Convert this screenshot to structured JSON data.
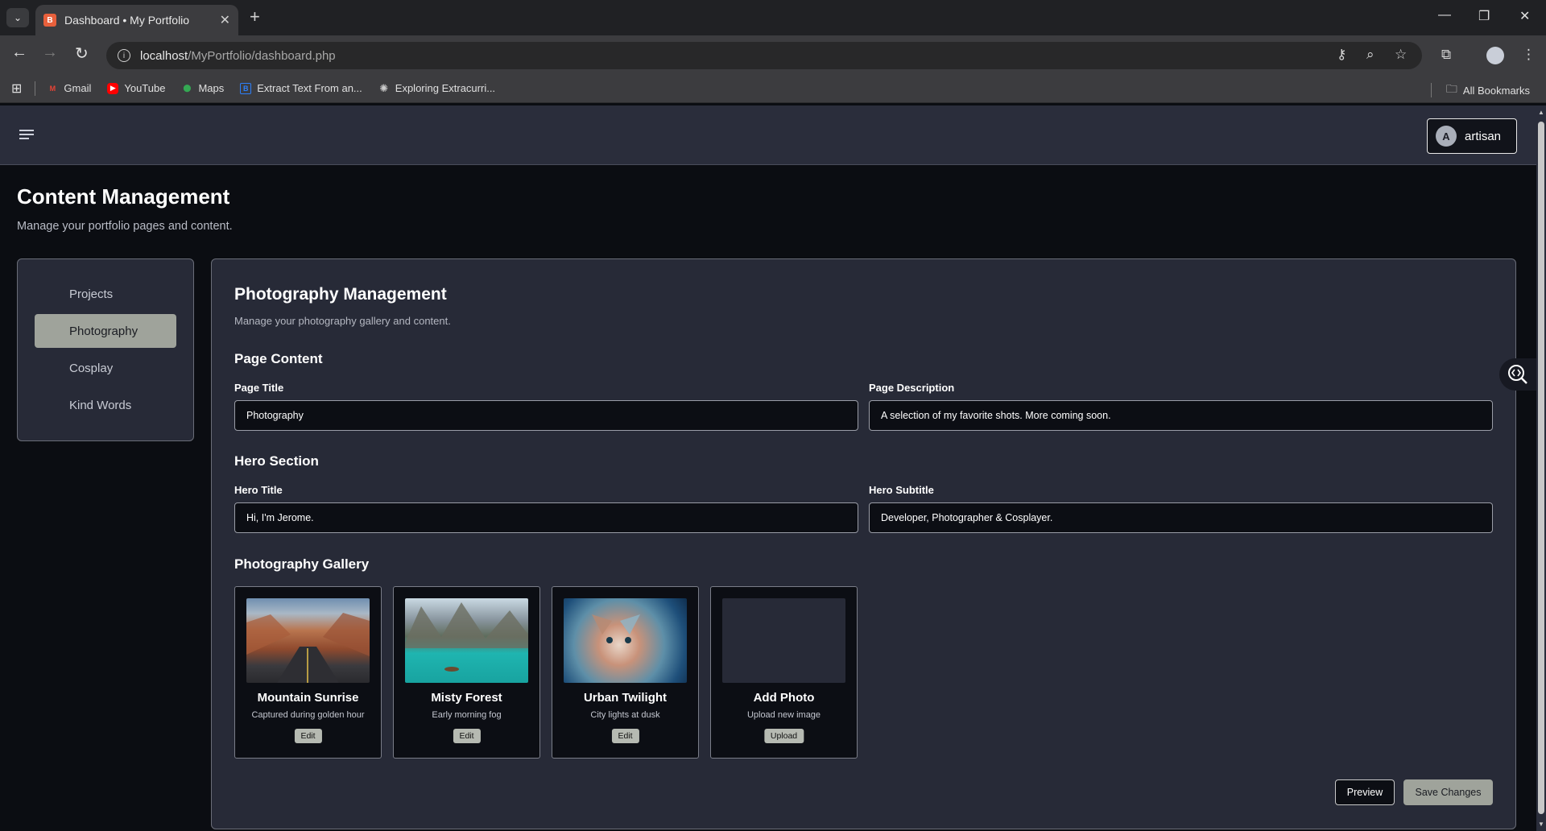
{
  "browser": {
    "tab_title": "Dashboard • My Portfolio",
    "url_host": "localhost",
    "url_path": "/MyPortfolio/dashboard.php",
    "bookmarks": [
      {
        "label": "Gmail",
        "icon": "gmail-icon",
        "color": "#ea4335"
      },
      {
        "label": "YouTube",
        "icon": "youtube-icon",
        "color": "#ff0000"
      },
      {
        "label": "Maps",
        "icon": "maps-icon",
        "color": "#34a853"
      },
      {
        "label": "Extract Text From an...",
        "icon": "bookmark-b-icon",
        "color": "#2d7ff9"
      },
      {
        "label": "Exploring Extracurri...",
        "icon": "openai-icon",
        "color": "#cccccc"
      }
    ],
    "all_bookmarks": "All Bookmarks"
  },
  "header": {
    "avatar_initial": "A",
    "user_name": "artisan"
  },
  "page": {
    "title": "Content Management",
    "subtitle": "Manage your portfolio pages and content."
  },
  "sidebar": {
    "items": [
      {
        "label": "Projects",
        "active": false
      },
      {
        "label": "Photography",
        "active": true
      },
      {
        "label": "Cosplay",
        "active": false
      },
      {
        "label": "Kind Words",
        "active": false
      }
    ]
  },
  "main": {
    "title": "Photography Management",
    "subtitle": "Manage your photography gallery and content.",
    "page_content": {
      "heading": "Page Content",
      "title_label": "Page Title",
      "title_value": "Photography",
      "desc_label": "Page Description",
      "desc_value": "A selection of my favorite shots. More coming soon."
    },
    "hero": {
      "heading": "Hero Section",
      "title_label": "Hero Title",
      "title_value": "Hi, I'm Jerome.",
      "subtitle_label": "Hero Subtitle",
      "subtitle_value": "Developer, Photographer & Cosplayer."
    },
    "gallery": {
      "heading": "Photography Gallery",
      "cards": [
        {
          "title": "Mountain Sunrise",
          "caption": "Captured during golden hour",
          "button": "Edit"
        },
        {
          "title": "Misty Forest",
          "caption": "Early morning fog",
          "button": "Edit"
        },
        {
          "title": "Urban Twilight",
          "caption": "City lights at dusk",
          "button": "Edit"
        },
        {
          "title": "Add Photo",
          "caption": "Upload new image",
          "button": "Upload"
        }
      ]
    },
    "preview_label": "Preview",
    "save_label": "Save Changes"
  }
}
